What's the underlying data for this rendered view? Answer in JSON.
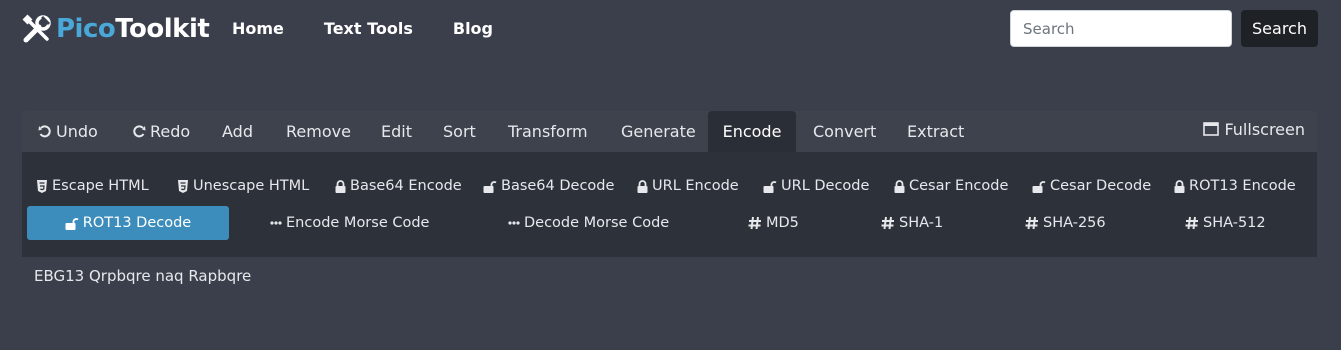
{
  "logo": {
    "pico": "Pico",
    "toolkit": "Toolkit"
  },
  "nav": {
    "home": "Home",
    "text_tools": "Text Tools",
    "blog": "Blog"
  },
  "search": {
    "placeholder": "Search",
    "button": "Search"
  },
  "tabs": {
    "undo": "Undo",
    "redo": "Redo",
    "add": "Add",
    "remove": "Remove",
    "edit": "Edit",
    "sort": "Sort",
    "transform": "Transform",
    "generate": "Generate",
    "encode": "Encode",
    "convert": "Convert",
    "extract": "Extract",
    "fullscreen": "Fullscreen",
    "active": "Encode"
  },
  "encode_buttons": {
    "escape_html": "Escape HTML",
    "unescape_html": "Unescape HTML",
    "base64_encode": "Base64 Encode",
    "base64_decode": "Base64 Decode",
    "url_encode": "URL Encode",
    "url_decode": "URL Decode",
    "cesar_encode": "Cesar Encode",
    "cesar_decode": "Cesar Decode",
    "rot13_encode": "ROT13 Encode",
    "rot13_decode": "ROT13 Decode",
    "encode_morse": "Encode Morse Code",
    "decode_morse": "Decode Morse Code",
    "md5": "MD5",
    "sha1": "SHA-1",
    "sha256": "SHA-256",
    "sha512": "SHA-512",
    "active": "ROT13 Decode"
  },
  "editor": {
    "text": "EBG13 Qrpbqre naq Rapbqre"
  },
  "colors": {
    "accent": "#3c8dbc",
    "brand": "#4aa8d8",
    "background": "#3a3f4b"
  }
}
